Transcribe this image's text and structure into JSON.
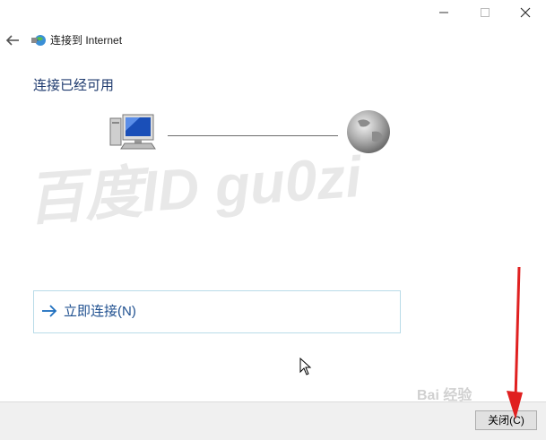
{
  "window": {
    "title": "连接到 Internet",
    "main_heading": "连接已经可用"
  },
  "connect_option": {
    "label": "立即连接(N)"
  },
  "footer": {
    "close_label": "关闭(C)"
  },
  "watermarks": {
    "main": "百度ID  gu0zi",
    "corner": "Bai 经验"
  },
  "icons": {
    "back": "back-arrow-icon",
    "network": "network-globe-icon",
    "computer": "computer-icon",
    "globe": "globe-icon",
    "connect_arrow": "right-arrow-icon"
  },
  "colors": {
    "heading": "#1e3a6e",
    "link": "#1e4f8f",
    "option_border": "#b9dbe8",
    "footer_bg": "#f0f0f0",
    "annotation_arrow": "#e02020"
  }
}
